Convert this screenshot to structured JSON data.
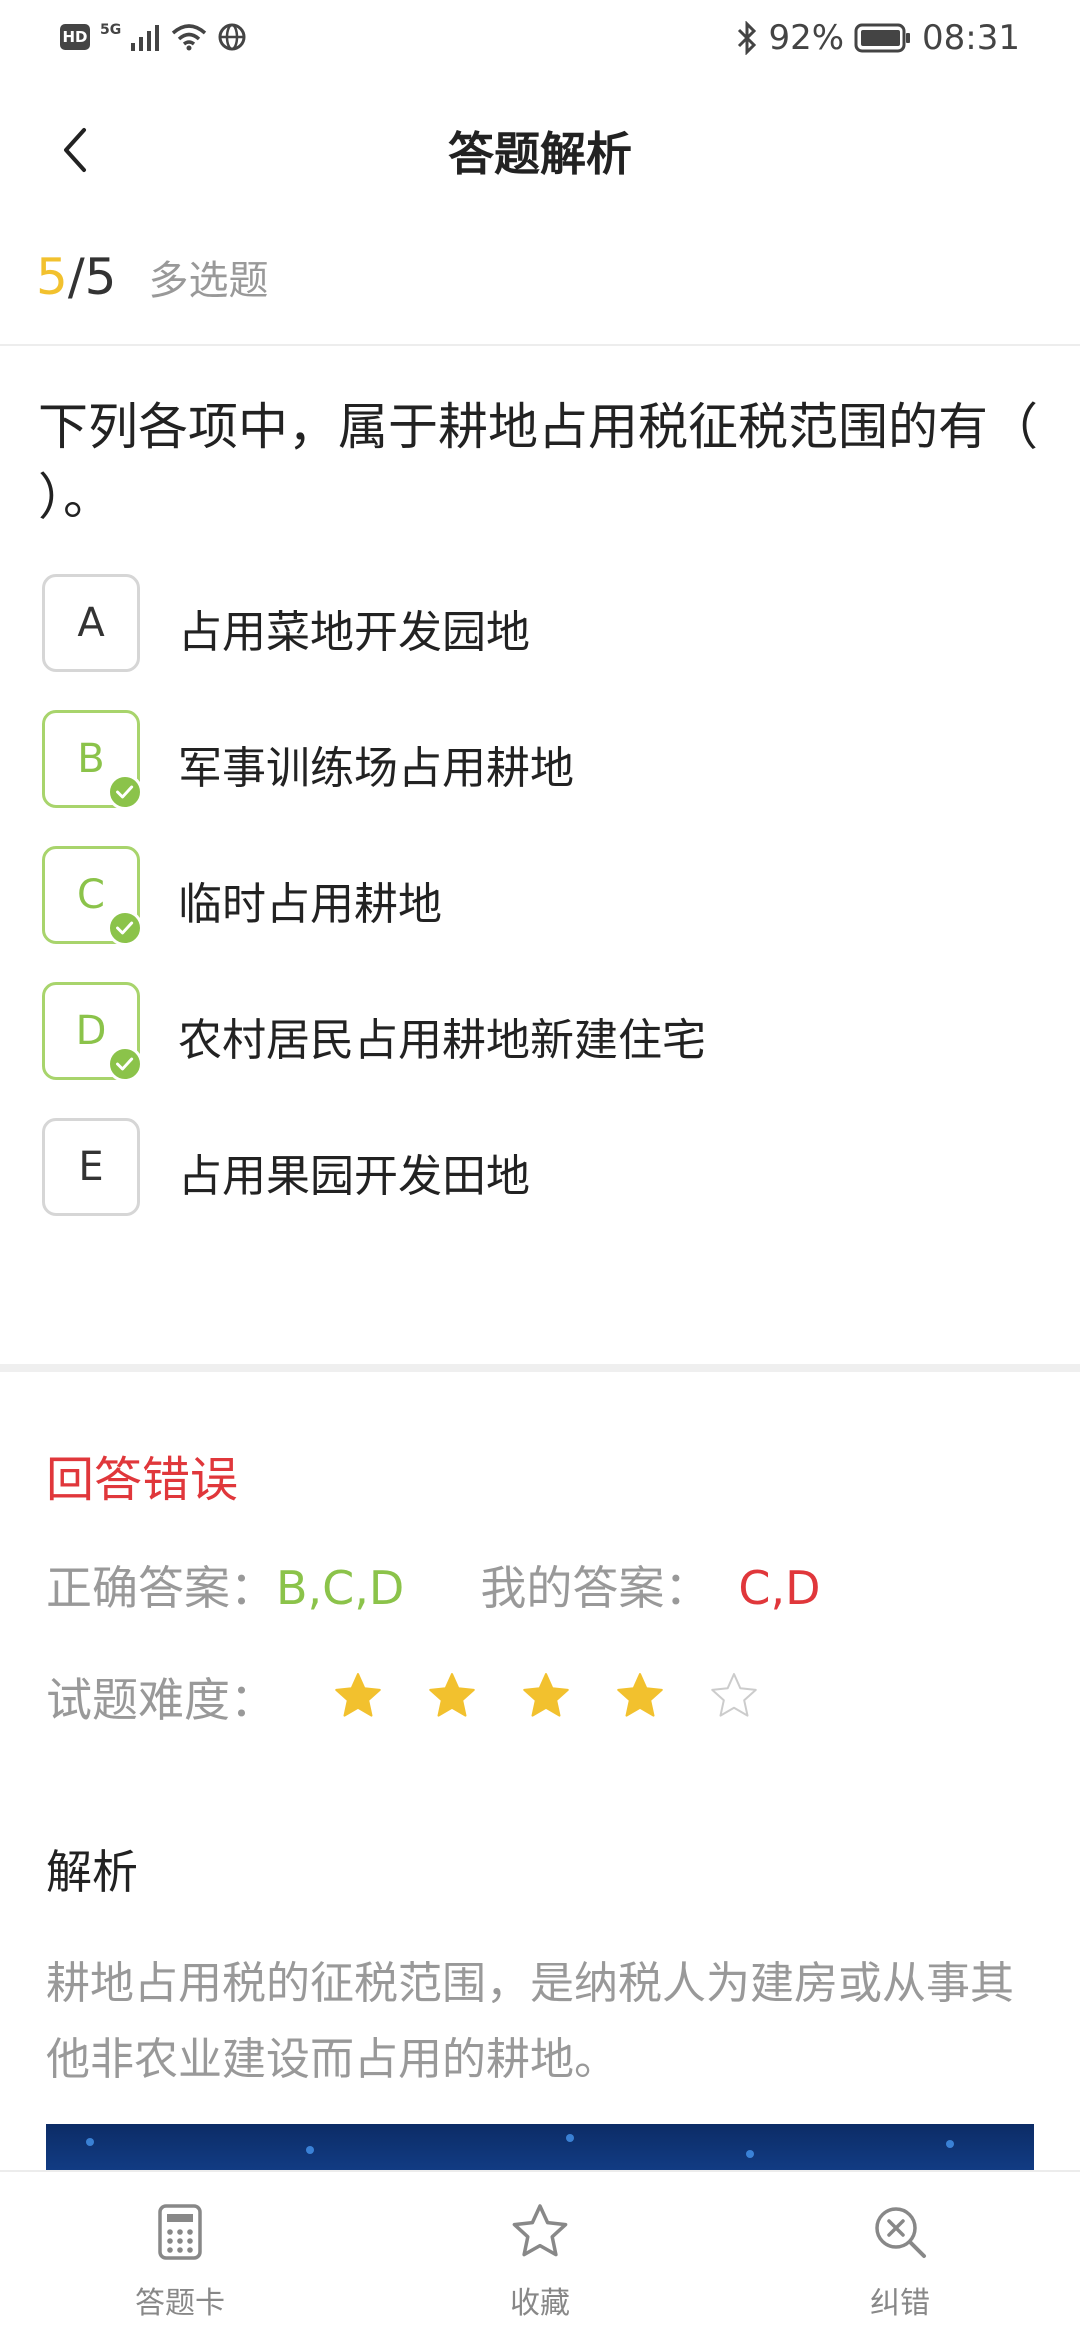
{
  "status": {
    "network": "5G",
    "battery": "92%",
    "time": "08:31"
  },
  "nav": {
    "title": "答题解析"
  },
  "question": {
    "current": "5",
    "separator": "/",
    "total": "5",
    "type": "多选题",
    "text": "下列各项中，属于耕地占用税征税范围的有（ ）。",
    "options": [
      {
        "letter": "A",
        "text": "占用菜地开发园地",
        "correct": false
      },
      {
        "letter": "B",
        "text": "军事训练场占用耕地",
        "correct": true
      },
      {
        "letter": "C",
        "text": "临时占用耕地",
        "correct": true
      },
      {
        "letter": "D",
        "text": "农村居民占用耕地新建住宅",
        "correct": true
      },
      {
        "letter": "E",
        "text": "占用果园开发田地",
        "correct": false
      }
    ]
  },
  "result": {
    "title": "回答错误",
    "correct_label": "正确答案：",
    "correct_value": "B,C,D",
    "my_label": "我的答案：",
    "my_value": "C,D",
    "difficulty_label": "试题难度：",
    "difficulty_stars": 4,
    "difficulty_max": 5
  },
  "analysis": {
    "title": "解析",
    "text": "耕地占用税的征税范围，是纳税人为建房或从事其他非农业建设而占用的耕地。"
  },
  "bottom_tabs": {
    "answer_card": "答题卡",
    "favorite": "收藏",
    "report_error": "纠错"
  },
  "colors": {
    "accent_yellow": "#f2c12e",
    "correct_green": "#8bc34a",
    "error_red": "#e0373b"
  }
}
